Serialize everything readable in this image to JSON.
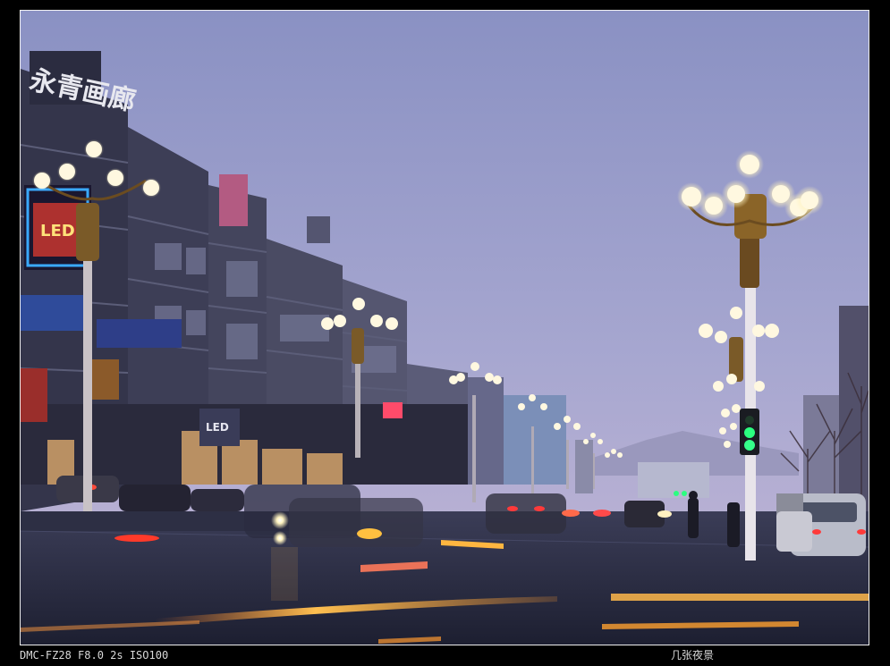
{
  "photo": {
    "subject": "night street scene with ornate street lamps, buildings and car light trails",
    "colors": {
      "sky_top": "#8d94c4",
      "sky_bottom": "#bdb6d8",
      "road": "#2c2f45",
      "lamp_glow": "#fff6c8",
      "trail": "#ffb640",
      "signal_green": "#23ff7a"
    },
    "signs": {
      "rooftop_sign": "永青画廊",
      "left_tall_sign": "LED",
      "store_sign": "LED"
    }
  },
  "captions": {
    "exif": "DMC-FZ28 F8.0 2s ISO100",
    "title": "几张夜景"
  }
}
